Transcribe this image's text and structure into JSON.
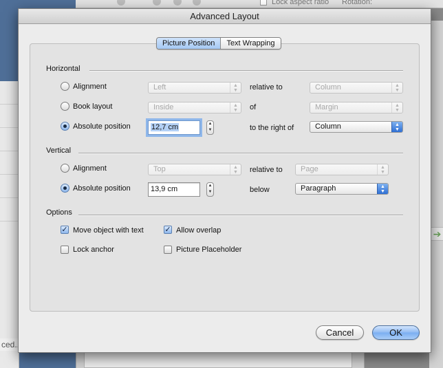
{
  "background": {
    "toolbar": {
      "lock_aspect_ratio": "Lock aspect ratio",
      "rotation": "Rotation:"
    },
    "left_panel_text": "ced..."
  },
  "dialog": {
    "title": "Advanced Layout",
    "tabs": [
      {
        "label": "Picture Position",
        "active": true
      },
      {
        "label": "Text Wrapping",
        "active": false
      }
    ],
    "horizontal": {
      "title": "Horizontal",
      "alignment": {
        "label": "Alignment",
        "value": "Left",
        "relation_label": "relative to",
        "relation_value": "Column"
      },
      "book_layout": {
        "label": "Book layout",
        "value": "Inside",
        "relation_label": "of",
        "relation_value": "Margin"
      },
      "absolute_position": {
        "label": "Absolute position",
        "value": "12,7 cm",
        "relation_label": "to the right of",
        "relation_value": "Column"
      }
    },
    "vertical": {
      "title": "Vertical",
      "alignment": {
        "label": "Alignment",
        "value": "Top",
        "relation_label": "relative to",
        "relation_value": "Page"
      },
      "absolute_position": {
        "label": "Absolute position",
        "value": "13,9 cm",
        "relation_label": "below",
        "relation_value": "Paragraph"
      }
    },
    "options": {
      "title": "Options",
      "move_object_with_text": {
        "label": "Move object with text",
        "checked": true
      },
      "allow_overlap": {
        "label": "Allow overlap",
        "checked": true
      },
      "lock_anchor": {
        "label": "Lock anchor",
        "checked": false
      },
      "picture_placeholder": {
        "label": "Picture Placeholder",
        "checked": false
      }
    },
    "buttons": {
      "cancel": "Cancel",
      "ok": "OK"
    }
  },
  "icons": {
    "popup_arrows": "updown-arrows-icon",
    "stepper": "stepper-arrows-icon",
    "check": "checkmark-icon",
    "side_arrow": "green-arrow-icon"
  },
  "colors": {
    "selection_blue": "#b3d0f5",
    "focus_ring": "#8fb7ea",
    "default_button": "#8fbaf2"
  }
}
